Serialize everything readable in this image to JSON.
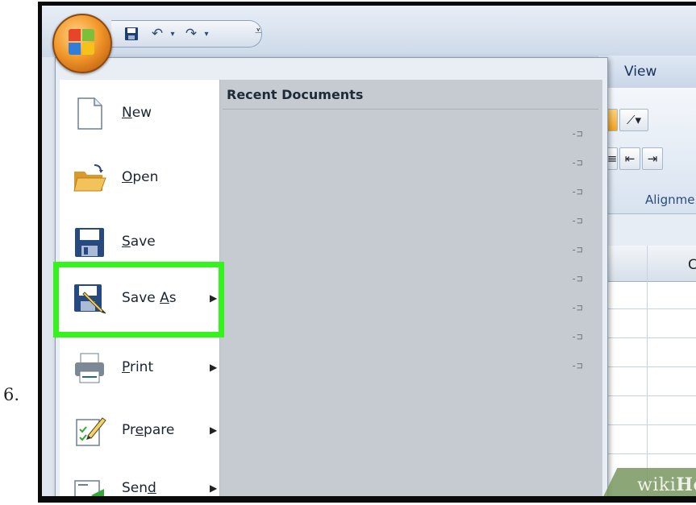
{
  "step_number": "6.",
  "qat": {
    "save_icon": "floppy-icon",
    "undo_icon": "undo-icon",
    "redo_icon": "redo-icon",
    "customize_icon": "dropdown-caret-icon"
  },
  "ribbon": {
    "tab_view": "View",
    "group_label": "Alignme",
    "column_header": "C"
  },
  "recent": {
    "title": "Recent Documents",
    "pin_count": 9
  },
  "menu": {
    "items": [
      {
        "label": "New",
        "underline": "N",
        "rest": "ew",
        "icon": "new-document-icon",
        "has_submenu": false
      },
      {
        "label": "Open",
        "underline": "O",
        "rest": "pen",
        "icon": "open-folder-icon",
        "has_submenu": false
      },
      {
        "label": "Save",
        "underline": "S",
        "rest": "ave",
        "icon": "save-floppy-icon",
        "has_submenu": false
      },
      {
        "label": "Save As",
        "prefix": "Save ",
        "underline": "A",
        "rest": "s",
        "icon": "save-as-icon",
        "has_submenu": true,
        "highlighted": true
      },
      {
        "label": "Print",
        "underline": "P",
        "rest": "rint",
        "icon": "printer-icon",
        "has_submenu": true
      },
      {
        "label": "Prepare",
        "prefix": "Pr",
        "underline": "e",
        "rest": "pare",
        "icon": "prepare-icon",
        "has_submenu": true
      },
      {
        "label": "Send",
        "prefix": "Sen",
        "underline": "d",
        "rest": "",
        "icon": "send-icon",
        "has_submenu": true
      }
    ]
  },
  "highlight_color": "#35f41e",
  "watermark": {
    "text": "wikiHow",
    "part1": "wiki",
    "part2": "How"
  }
}
